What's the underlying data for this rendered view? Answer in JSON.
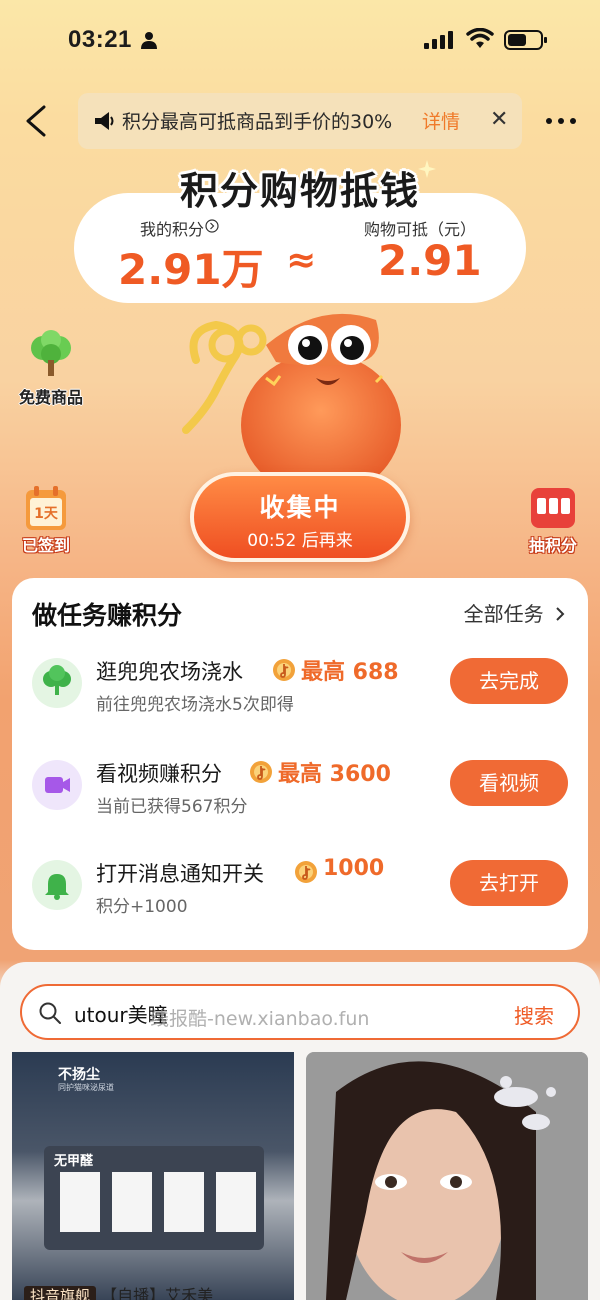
{
  "status_bar": {
    "time": "03:21"
  },
  "notice": {
    "message": "积分最高可抵商品到手价的30%",
    "detail": "详情",
    "close": "✕"
  },
  "header": {
    "title": "积分购物抵钱",
    "my_points_label": "我的积分",
    "my_points_value": "2.91万",
    "approx": "≈",
    "deduct_label": "购物可抵（元）",
    "deduct_value": "2.91"
  },
  "side": {
    "free_goods": "免费商品",
    "signed_in": "已签到",
    "signed_badge": "1天",
    "draw_points": "抽积分"
  },
  "collect": {
    "main": "收集中",
    "sub": "00:52 后再来"
  },
  "tasks": {
    "title": "做任务赚积分",
    "all_tasks": "全部任务",
    "items": [
      {
        "title": "逛兜兜农场浇水",
        "reward": "最高 688",
        "desc": "前往兜兜农场浇水5次即得",
        "button": "去完成",
        "icon": "tree-icon",
        "icon_bg": "#e4f5e3"
      },
      {
        "title": "看视频赚积分",
        "reward": "最高 3600",
        "desc": "当前已获得567积分",
        "button": "看视频",
        "icon": "video-camera-icon",
        "icon_bg": "#efe6fb"
      },
      {
        "title": "打开消息通知开关",
        "reward": "1000",
        "desc": "积分+1000",
        "button": "去打开",
        "icon": "bell-icon",
        "icon_bg": "#e4f5e3"
      }
    ]
  },
  "search": {
    "value": "utour美瞳",
    "button": "搜索",
    "watermark": "线报酷-new.xianbao.fun"
  },
  "products": [
    {
      "top_text": "不扬尘",
      "top_sub": "同护猫咪泌尿道",
      "panel_title": "无甲醛"
    },
    {
      "top_text": ""
    }
  ],
  "product_caption": {
    "badge": "抖音旗舰",
    "text": "【自播】艾禾美"
  },
  "colors": {
    "accent": "#ef5a24",
    "button": "#f06a35",
    "text": "#1a1a1a"
  }
}
